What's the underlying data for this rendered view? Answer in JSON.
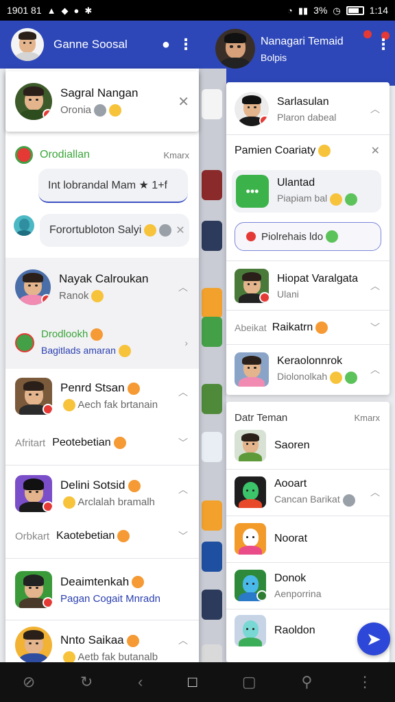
{
  "status_bar": {
    "left_text": "1901 81",
    "battery_text": "3%",
    "time": "1:14"
  },
  "header_left": {
    "title": "Ganne Soosal"
  },
  "header_right": {
    "title": "Nanagari Temaid",
    "subtitle": "Bolpis"
  },
  "top_card": {
    "name": "Sagral Nangan",
    "sub": "Oronia"
  },
  "chat": {
    "sender": "Orodiallan",
    "action": "Kmarx",
    "bubble1": "Int lobrandal Mam ★ 1+f",
    "bubble2": "Forortubloton Salyi"
  },
  "left_items": [
    {
      "name": "Nayak Calroukan",
      "sub": "Ranok"
    },
    {
      "name": "Drodlookh",
      "sub": "Bagitlads amaran"
    },
    {
      "name": "Penrd Stsan",
      "sub": "Aech fak brtanain"
    },
    {
      "name": "Peotebetian",
      "prefix": "Afritart"
    },
    {
      "name": "Delini Sotsid",
      "sub": "Arclalah bramalh"
    },
    {
      "name": "Kaotebetian",
      "prefix": "Orbkart"
    },
    {
      "name": "Deaimtenkah",
      "sub": "Pagan Cogait Mnradn"
    },
    {
      "name": "Nnto Saikaa",
      "sub": "Aetb fak butanalb"
    }
  ],
  "right_items": [
    {
      "name": "Sarlasulan",
      "sub": "Plaron dabeal"
    },
    {
      "name": "Pamien Coariaty"
    },
    {
      "name": "Ulantad",
      "sub": "Piapiam bal"
    },
    {
      "name": "Piolrehais ldo"
    },
    {
      "name": "Hiopat Varalgata",
      "sub": "Ulani"
    },
    {
      "name": "Raikatrn",
      "prefix": "Abeikat"
    },
    {
      "name": "Keraolonnrok",
      "sub": "Diolonolkah"
    }
  ],
  "section": {
    "title": "Datr Teman",
    "action": "Kmarx"
  },
  "friends": [
    {
      "name": "Saoren"
    },
    {
      "name": "Aooart",
      "sub": "Cancan Barikat"
    },
    {
      "name": "Noorat"
    },
    {
      "name": "Donok",
      "sub": "Aenporrina"
    },
    {
      "name": "Raoldon"
    }
  ],
  "colors": {
    "header": "#2d47b8",
    "fab": "#2d47d8",
    "accent_green": "#3aa53a",
    "link_blue": "#2a3fb0"
  }
}
